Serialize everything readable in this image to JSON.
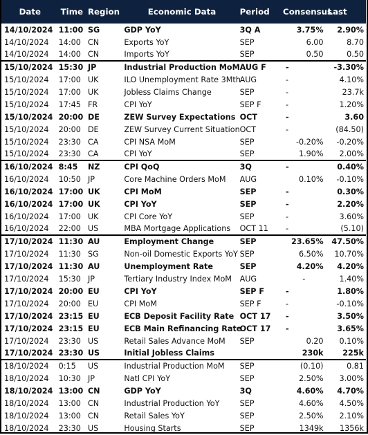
{
  "header": {
    "date": "Date",
    "time": "Time",
    "region": "Region",
    "data": "Economic Data",
    "period": "Period",
    "consensus": "Consensus",
    "last": "Last"
  },
  "colors": {
    "header_bg": "#0e2240",
    "header_text": "#ffffff"
  },
  "rows": [
    {
      "date": "14/10/2024",
      "time": "11:00",
      "region": "SG",
      "data": "GDP YoY",
      "period": "3Q A",
      "consensus": "3.75%",
      "last": "2.90%",
      "bold": true,
      "day_start": false
    },
    {
      "date": "14/10/2024",
      "time": "14:00",
      "region": "CN",
      "data": "Exports YoY",
      "period": "SEP",
      "consensus": "6.00",
      "last": "8.70",
      "bold": false,
      "day_start": false
    },
    {
      "date": "14/10/2024",
      "time": "14:00",
      "region": "CN",
      "data": "Imports YoY",
      "period": "SEP",
      "consensus": "0.50",
      "last": "0.50",
      "bold": false,
      "day_start": false
    },
    {
      "date": "15/10/2024",
      "time": "15:30",
      "region": "JP",
      "data": "Industrial Production MoM",
      "period": "AUG F",
      "consensus": "-",
      "last": "-3.30%",
      "bold": true,
      "day_start": true
    },
    {
      "date": "15/10/2024",
      "time": "17:00",
      "region": "UK",
      "data": "ILO Unemployment Rate 3Mth",
      "period": "AUG",
      "consensus": "-",
      "last": "4.10%",
      "bold": false,
      "day_start": false
    },
    {
      "date": "15/10/2024",
      "time": "17:00",
      "region": "UK",
      "data": "Jobless Claims Change",
      "period": "SEP",
      "consensus": "-",
      "last": "23.7k",
      "bold": false,
      "day_start": false
    },
    {
      "date": "15/10/2024",
      "time": "17:45",
      "region": "FR",
      "data": "CPI YoY",
      "period": "SEP F",
      "consensus": "-",
      "last": "1.20%",
      "bold": false,
      "day_start": false
    },
    {
      "date": "15/10/2024",
      "time": "20:00",
      "region": "DE",
      "data": "ZEW Survey Expectations",
      "period": "OCT",
      "consensus": "-",
      "last": "3.60",
      "bold": true,
      "day_start": false
    },
    {
      "date": "15/10/2024",
      "time": "20:00",
      "region": "DE",
      "data": "ZEW Survey Current Situation",
      "period": "OCT",
      "consensus": "-",
      "last": "(84.50)",
      "bold": false,
      "day_start": false
    },
    {
      "date": "15/10/2024",
      "time": "23:30",
      "region": "CA",
      "data": "CPI NSA MoM",
      "period": "SEP",
      "consensus": "-0.20%",
      "last": "-0.20%",
      "bold": false,
      "day_start": false
    },
    {
      "date": "15/10/2024",
      "time": "23:30",
      "region": "CA",
      "data": "CPI YoY",
      "period": "SEP",
      "consensus": "1.90%",
      "last": "2.00%",
      "bold": false,
      "day_start": false
    },
    {
      "date": "16/10/2024",
      "time": "8:45",
      "region": "NZ",
      "data": "CPI QoQ",
      "period": "3Q",
      "consensus": "-",
      "last": "0.40%",
      "bold": true,
      "day_start": true
    },
    {
      "date": "16/10/2024",
      "time": "10:50",
      "region": "JP",
      "data": "Core Machine Orders MoM",
      "period": "AUG",
      "consensus": "0.10%",
      "last": "-0.10%",
      "bold": false,
      "day_start": false
    },
    {
      "date": "16/10/2024",
      "time": "17:00",
      "region": "UK",
      "data": "CPI MoM",
      "period": "SEP",
      "consensus": "-",
      "last": "0.30%",
      "bold": true,
      "day_start": false
    },
    {
      "date": "16/10/2024",
      "time": "17:00",
      "region": "UK",
      "data": "CPI YoY",
      "period": "SEP",
      "consensus": "-",
      "last": "2.20%",
      "bold": true,
      "day_start": false
    },
    {
      "date": "16/10/2024",
      "time": "17:00",
      "region": "UK",
      "data": "CPI Core YoY",
      "period": "SEP",
      "consensus": "-",
      "last": "3.60%",
      "bold": false,
      "day_start": false
    },
    {
      "date": "16/10/2024",
      "time": "22:00",
      "region": "US",
      "data": "MBA Mortgage Applications",
      "period": "OCT 11",
      "consensus": "-",
      "last": "(5.10)",
      "bold": false,
      "day_start": false
    },
    {
      "date": "17/10/2024",
      "time": "11:30",
      "region": "AU",
      "data": "Employment Change",
      "period": "SEP",
      "consensus": "23.65%",
      "last": "47.50%",
      "bold": true,
      "day_start": true
    },
    {
      "date": "17/10/2024",
      "time": "11:30",
      "region": "SG",
      "data": "Non-oil Domestic Exports YoY",
      "period": "SEP",
      "consensus": "6.50%",
      "last": "10.70%",
      "bold": false,
      "day_start": false
    },
    {
      "date": "17/10/2024",
      "time": "11:30",
      "region": "AU",
      "data": "Unemployment Rate",
      "period": "SEP",
      "consensus": "4.20%",
      "last": "4.20%",
      "bold": true,
      "day_start": false
    },
    {
      "date": "17/10/2024",
      "time": "15:30",
      "region": "JP",
      "data": "Tertiary Industry Index MoM",
      "period": "AUG",
      "consensus": "-",
      "last": "1.40%",
      "bold": false,
      "day_start": false,
      "dash_center": true
    },
    {
      "date": "17/10/2024",
      "time": "20:00",
      "region": "EU",
      "data": "CPI YoY",
      "period": "SEP F",
      "consensus": "-",
      "last": "1.80%",
      "bold": true,
      "day_start": false
    },
    {
      "date": "17/10/2024",
      "time": "20:00",
      "region": "EU",
      "data": "CPI MoM",
      "period": "SEP F",
      "consensus": "-",
      "last": "-0.10%",
      "bold": false,
      "day_start": false
    },
    {
      "date": "17/10/2024",
      "time": "23:15",
      "region": "EU",
      "data": "ECB Deposit Facility Rate",
      "period": "OCT 17",
      "consensus": "-",
      "last": "3.50%",
      "bold": true,
      "day_start": false
    },
    {
      "date": "17/10/2024",
      "time": "23:15",
      "region": "EU",
      "data": "ECB Main Refinancing Rate",
      "period": "OCT 17",
      "consensus": "-",
      "last": "3.65%",
      "bold": true,
      "day_start": false
    },
    {
      "date": "17/10/2024",
      "time": "23:30",
      "region": "US",
      "data": "Retail Sales Advance MoM",
      "period": "SEP",
      "consensus": "0.20",
      "last": "0.10%",
      "bold": false,
      "day_start": false
    },
    {
      "date": "17/10/2024",
      "time": "23:30",
      "region": "US",
      "data": "Initial Jobless Claims",
      "period": "",
      "consensus": "230k",
      "last": "225k",
      "bold": true,
      "day_start": false
    },
    {
      "date": "18/10/2024",
      "time": "0:15",
      "region": "US",
      "data": "Industrial Production MoM",
      "period": "SEP",
      "consensus": "(0.10)",
      "last": "0.81",
      "bold": false,
      "day_start": true
    },
    {
      "date": "18/10/2024",
      "time": "10:30",
      "region": "JP",
      "data": "Natl CPI YoY",
      "period": "SEP",
      "consensus": "2.50%",
      "last": "3.00%",
      "bold": false,
      "day_start": false
    },
    {
      "date": "18/10/2024",
      "time": "13:00",
      "region": "CN",
      "data": "GDP YoY",
      "period": "3Q",
      "consensus": "4.60%",
      "last": "4.70%",
      "bold": true,
      "day_start": false
    },
    {
      "date": "18/10/2024",
      "time": "13:00",
      "region": "CN",
      "data": "Industrial Production YoY",
      "period": "SEP",
      "consensus": "4.60%",
      "last": "4.50%",
      "bold": false,
      "day_start": false
    },
    {
      "date": "18/10/2024",
      "time": "13:00",
      "region": "CN",
      "data": "Retail Sales YoY",
      "period": "SEP",
      "consensus": "2.50%",
      "last": "2.10%",
      "bold": false,
      "day_start": false
    },
    {
      "date": "18/10/2024",
      "time": "23:30",
      "region": "US",
      "data": "Housing Starts",
      "period": "SEP",
      "consensus": "1349k",
      "last": "1356k",
      "bold": false,
      "day_start": false
    }
  ]
}
